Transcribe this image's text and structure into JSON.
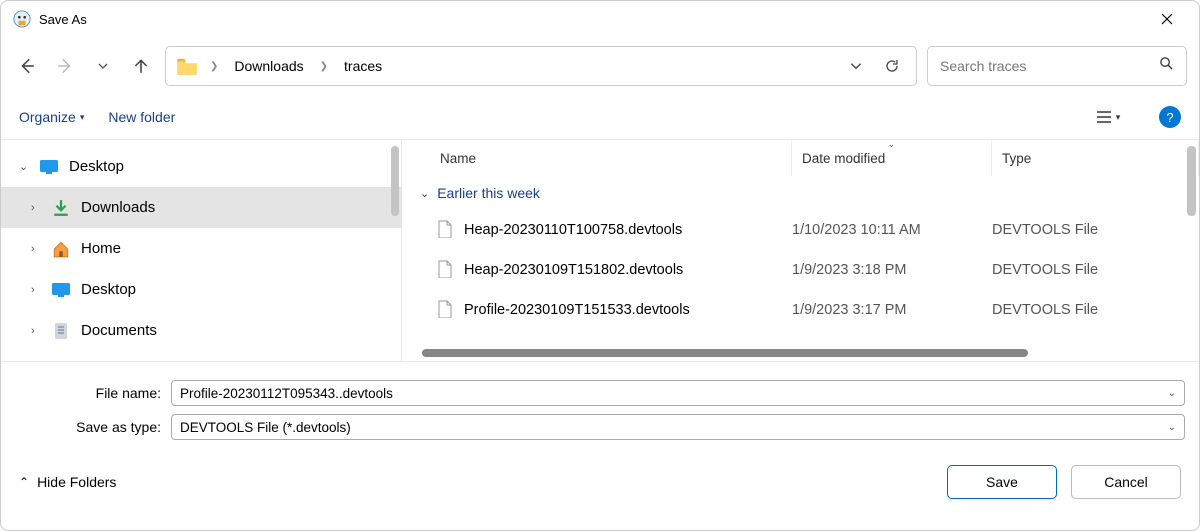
{
  "window": {
    "title": "Save As"
  },
  "breadcrumbs": {
    "item0": "Downloads",
    "item1": "traces"
  },
  "search": {
    "placeholder": "Search traces"
  },
  "toolbar": {
    "organize": "Organize",
    "new_folder": "New folder"
  },
  "sidebar": {
    "items": [
      {
        "label": "Desktop"
      },
      {
        "label": "Downloads"
      },
      {
        "label": "Home"
      },
      {
        "label": "Desktop"
      },
      {
        "label": "Documents"
      }
    ]
  },
  "columns": {
    "name": "Name",
    "date": "Date modified",
    "type": "Type"
  },
  "group": {
    "label": "Earlier this week"
  },
  "files": [
    {
      "name": "Heap-20230110T100758.devtools",
      "date": "1/10/2023 10:11 AM",
      "type": "DEVTOOLS File"
    },
    {
      "name": "Heap-20230109T151802.devtools",
      "date": "1/9/2023 3:18 PM",
      "type": "DEVTOOLS File"
    },
    {
      "name": "Profile-20230109T151533.devtools",
      "date": "1/9/2023 3:17 PM",
      "type": "DEVTOOLS File"
    }
  ],
  "inputs": {
    "file_name_label": "File name:",
    "file_name_value": "Profile-20230112T095343..devtools",
    "save_type_label": "Save as type:",
    "save_type_value": "DEVTOOLS File (*.devtools)"
  },
  "footer": {
    "hide_folders": "Hide Folders",
    "save": "Save",
    "cancel": "Cancel"
  }
}
